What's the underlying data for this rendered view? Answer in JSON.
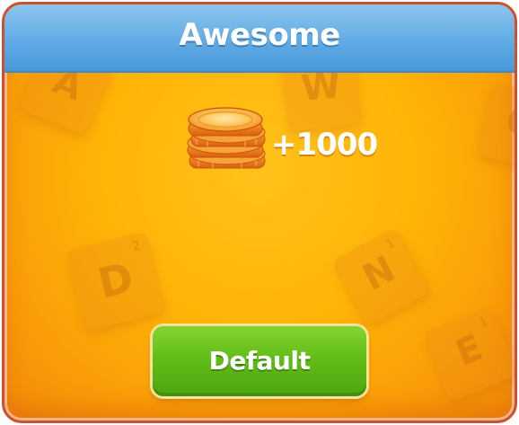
{
  "dialog": {
    "title": "Awesome",
    "reward_text": "+1000",
    "reward_icon": "coin-stack-icon",
    "button_label": "Default"
  },
  "background_tiles": [
    {
      "letter": "A",
      "sub": ""
    },
    {
      "letter": "W",
      "sub": ""
    },
    {
      "letter": "Q",
      "sub": ""
    },
    {
      "letter": "D",
      "sub": "2"
    },
    {
      "letter": "N",
      "sub": "1"
    },
    {
      "letter": "E",
      "sub": "1"
    }
  ],
  "colors": {
    "header": "#5da9e4",
    "panel": "#ffb307",
    "border": "#c8532e",
    "button": "#5fbb16",
    "coin": "#f08a1c"
  }
}
